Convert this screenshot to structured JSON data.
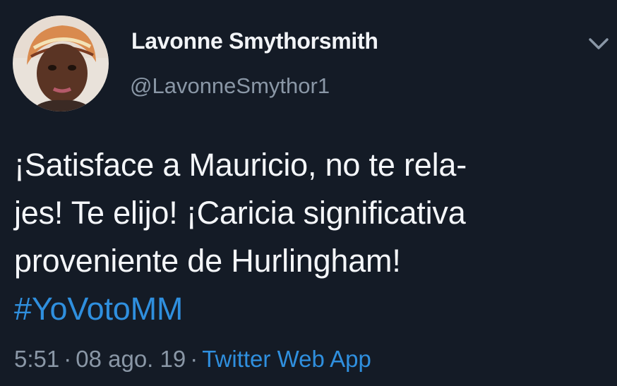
{
  "author": {
    "display_name": "Lavonne Smythorsmith",
    "handle": "@LavonneSmythor1"
  },
  "tweet": {
    "lines": [
      "¡Satisface a Mauricio, no te rela-",
      "jes! Te elijo! ¡Caricia significativa",
      "proveniente de Hurlingham!"
    ],
    "hashtag": "#YoVotoMM"
  },
  "meta": {
    "time": "5:51",
    "separator": "·",
    "date": "08 ago. 19",
    "source": "Twitter Web App"
  },
  "icons": {
    "menu": "chevron-down-icon"
  },
  "colors": {
    "background": "#141b26",
    "link": "#2f8fde",
    "secondary_text": "#8a97a6"
  }
}
